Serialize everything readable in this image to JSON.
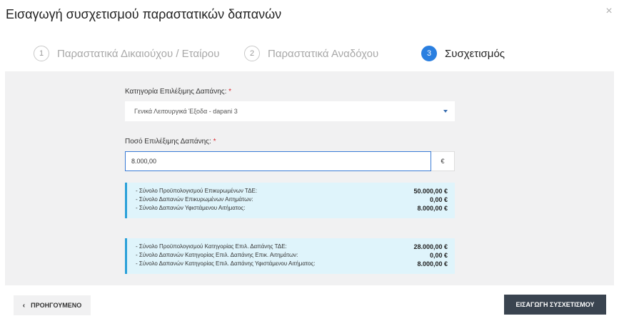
{
  "modal": {
    "title": "Εισαγωγή συσχετισμού παραστατικών δαπανών",
    "close_symbol": "×"
  },
  "steps": [
    {
      "number": "1",
      "label": "Παραστατικά Δικαιούχου / Εταίρου",
      "active": false
    },
    {
      "number": "2",
      "label": "Παραστατικά Αναδόχου",
      "active": false
    },
    {
      "number": "3",
      "label": "Συσχετισμός",
      "active": true
    }
  ],
  "form": {
    "category": {
      "label": "Κατηγορία Επιλέξιμης Δαπάνης:",
      "required_mark": "*",
      "selected": "Γενικά Λειτουργικά Έξοδα - dapani 3"
    },
    "amount": {
      "label": "Ποσό Επιλέξιμης Δαπάνης:",
      "required_mark": "*",
      "value": "8.000,00",
      "currency": "€"
    }
  },
  "summary_boxes": [
    {
      "rows": [
        {
          "label": "- Σύνολο Προϋπολογισμού Επικυρωμένων ΤΔΕ:",
          "value": "50.000,00 €"
        },
        {
          "label": "- Σύνολο Δαπανών Επικυρωμένων Αιτημάτων:",
          "value": "0,00 €"
        },
        {
          "label": "- Σύνολο Δαπανών Υφιστάμενου Αιτήματος:",
          "value": "8.000,00 €"
        }
      ]
    },
    {
      "rows": [
        {
          "label": "- Σύνολο Προϋπολογισμού Κατηγορίας Επιλ. Δαπάνης ΤΔΕ:",
          "value": "28.000,00 €"
        },
        {
          "label": "- Σύνολο Δαπανών Κατηγορίας Επιλ. Δαπάνης Επικ. Αιτημάτων:",
          "value": "0,00 €"
        },
        {
          "label": "- Σύνολο Δαπανών Κατηγορίας Επιλ. Δαπάνης Υφιστάμενου Αιτήματος:",
          "value": "8.000,00 €"
        }
      ]
    }
  ],
  "footer": {
    "prev_label": "ΠΡΟΗΓΟΥΜΕΝΟ",
    "prev_chevron": "‹",
    "submit_label": "ΕΙΣΑΓΩΓΗ ΣΥΣΧΕΤΙΣΜΟΥ"
  },
  "colors": {
    "accent": "#2a7fe0",
    "info_bg": "#dff4fb",
    "info_border": "#2aa0d8",
    "submit_bg": "#3a4450",
    "required": "#d9262e"
  }
}
